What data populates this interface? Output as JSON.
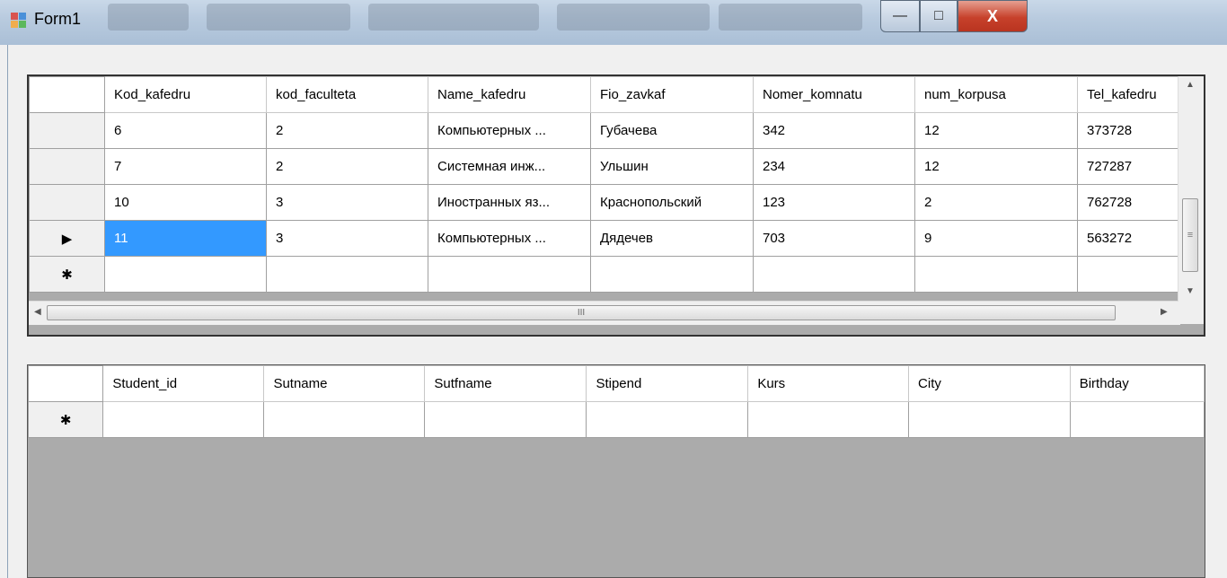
{
  "window": {
    "title": "Form1",
    "minimize_glyph": "—",
    "maximize_glyph": "□",
    "close_glyph": "X"
  },
  "grid1": {
    "columns": [
      "Kod_kafedru",
      "kod_faculteta",
      "Name_kafedru",
      "Fio_zavkaf",
      "Nomer_komnatu",
      "num_korpusa",
      "Tel_kafedru"
    ],
    "rows": [
      {
        "indicator": "",
        "cells": [
          "6",
          "2",
          "Компьютерных ...",
          "Губачева",
          "342",
          "12",
          "373728"
        ]
      },
      {
        "indicator": "",
        "cells": [
          "7",
          "2",
          "Системная инж...",
          "Ульшин",
          "234",
          "12",
          "727287"
        ]
      },
      {
        "indicator": "",
        "cells": [
          "10",
          "3",
          "Иностранных яз...",
          "Краснопольский",
          "123",
          "2",
          "762728"
        ]
      },
      {
        "indicator": "▶",
        "cells": [
          "11",
          "3",
          "Компьютерных ...",
          "Дядечев",
          "703",
          "9",
          "563272"
        ]
      },
      {
        "indicator": "✱",
        "cells": [
          "",
          "",
          "",
          "",
          "",
          "",
          ""
        ]
      }
    ],
    "hscroll_grip": "III",
    "vscroll_grip": "≡"
  },
  "grid2": {
    "columns": [
      "Student_id",
      "Sutname",
      "Sutfname",
      "Stipend",
      "Kurs",
      "City",
      "Birthday"
    ],
    "rows": [
      {
        "indicator": "✱",
        "cells": [
          "",
          "",
          "",
          "",
          "",
          "",
          ""
        ]
      }
    ]
  },
  "colors": {
    "selection": "#3399ff",
    "grid_background": "#ababab",
    "close_button": "#c7412b"
  }
}
